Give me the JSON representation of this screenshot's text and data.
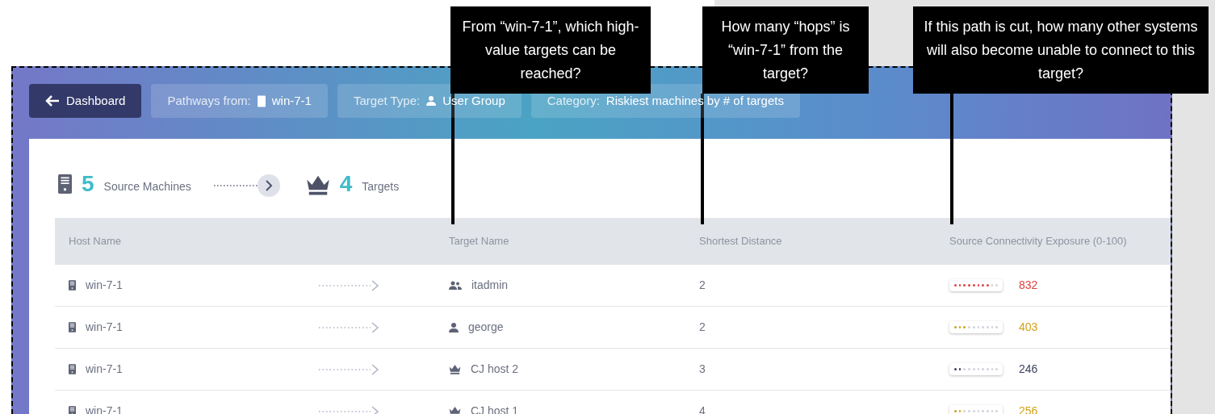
{
  "toolbar": {
    "back": "Dashboard",
    "pathways_label": "Pathways from:",
    "pathways_value": "win-7-1",
    "target_type_label": "Target Type:",
    "target_type_value": "User Group",
    "category_label": "Category:",
    "category_value": "Riskiest machines by # of targets"
  },
  "summary": {
    "sources_count": "5",
    "sources_label": "Source Machines",
    "targets_count": "4",
    "targets_label": "Targets"
  },
  "table": {
    "columns": [
      "Host Name",
      "Target Name",
      "Shortest Distance",
      "Source Connectivity Exposure (0-100)"
    ],
    "rows": [
      {
        "host": "win-7-1",
        "target": "itadmin",
        "kind": "group",
        "distance": "2",
        "level": 0.8,
        "color": "#e0413f",
        "exposure": "832"
      },
      {
        "host": "win-7-1",
        "target": "george",
        "kind": "user",
        "distance": "2",
        "level": 0.3,
        "color": "#d4a017",
        "exposure": "403"
      },
      {
        "host": "win-7-1",
        "target": "CJ host 2",
        "kind": "crown",
        "distance": "3",
        "level": 0.2,
        "color": "#3a3f5c",
        "exposure": "246"
      },
      {
        "host": "win-7-1",
        "target": "CJ host 1",
        "kind": "crown",
        "distance": "4",
        "level": 0.2,
        "color": "#d4a017",
        "exposure": "256"
      }
    ]
  },
  "callouts": [
    {
      "text": "From “win-7-1”, which high-value targets can be reached?"
    },
    {
      "text": "How many “hops” is “win-7-1” from the target?"
    },
    {
      "text": "If this path is cut, how many other systems will also become unable to connect to this target?"
    }
  ]
}
